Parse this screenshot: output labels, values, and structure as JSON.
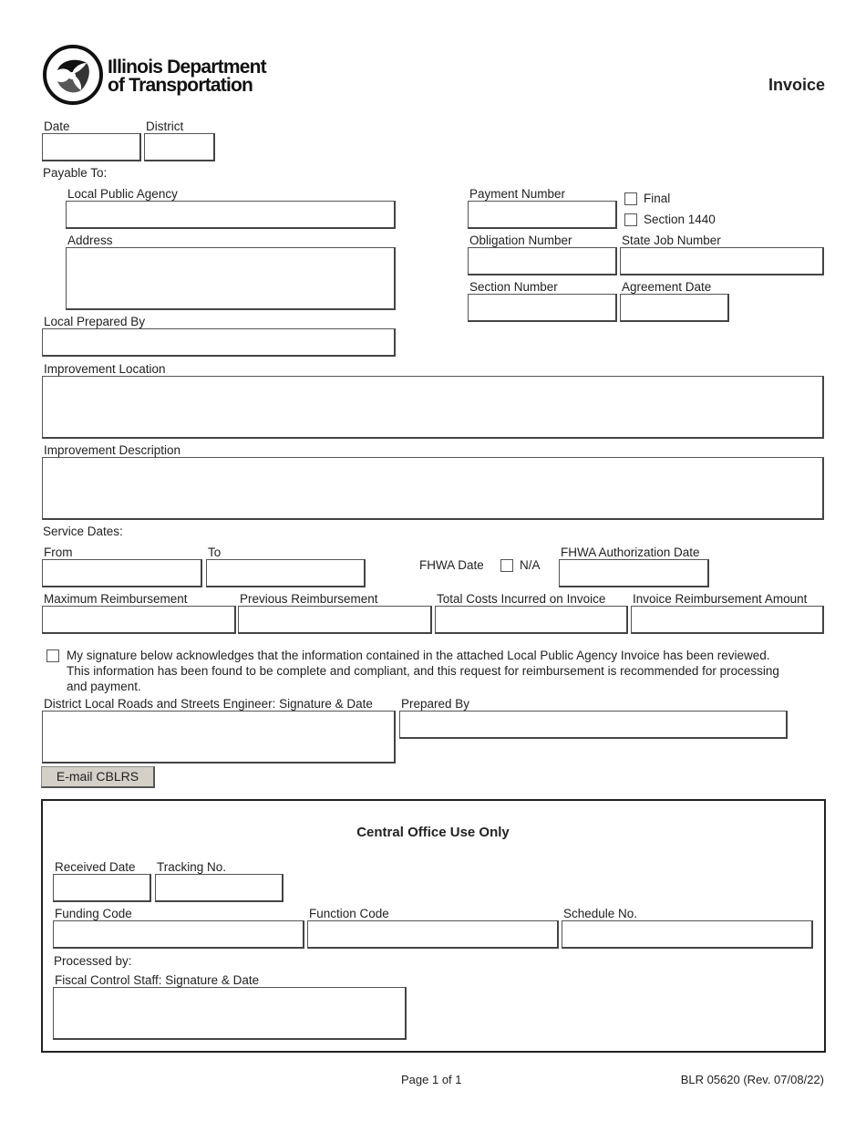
{
  "header": {
    "agency_line1": "Illinois Department",
    "agency_line2": "of Transportation",
    "form_title": "Invoice"
  },
  "fields": {
    "date": {
      "label": "Date",
      "value": ""
    },
    "district": {
      "label": "District",
      "value": ""
    },
    "payable_to": "Payable To:",
    "local_public_agency": {
      "label": "Local Public Agency",
      "value": ""
    },
    "address": {
      "label": "Address",
      "value": ""
    },
    "payment_number": {
      "label": "Payment Number",
      "value": ""
    },
    "final": {
      "label": "Final",
      "checked": false
    },
    "section_1440": {
      "label": "Section 1440",
      "checked": false
    },
    "obligation_number": {
      "label": "Obligation Number",
      "value": ""
    },
    "state_job_number": {
      "label": "State Job Number",
      "value": ""
    },
    "section_number": {
      "label": "Section Number",
      "value": ""
    },
    "agreement_date": {
      "label": "Agreement Date",
      "value": ""
    },
    "local_prepared_by": {
      "label": "Local Prepared By",
      "value": ""
    },
    "improvement_location": {
      "label": "Improvement Location",
      "value": ""
    },
    "improvement_description": {
      "label": "Improvement Description",
      "value": ""
    },
    "service_dates": "Service Dates:",
    "from": {
      "label": "From",
      "value": ""
    },
    "to": {
      "label": "To",
      "value": ""
    },
    "fhwa_date": {
      "label": "FHWA Date",
      "na_label": "N/A",
      "na_checked": false
    },
    "fhwa_authorization_date": {
      "label": "FHWA Authorization Date",
      "value": ""
    },
    "maximum_reimbursement": {
      "label": "Maximum Reimbursement",
      "value": ""
    },
    "previous_reimbursement": {
      "label": "Previous Reimbursement",
      "value": ""
    },
    "total_costs": {
      "label": "Total Costs Incurred on Invoice",
      "value": ""
    },
    "invoice_reimbursement_amount": {
      "label": "Invoice Reimbursement Amount",
      "value": ""
    },
    "acknowledgement": {
      "checked": false,
      "line1": "My signature below acknowledges that the information contained in the attached Local Public Agency Invoice has been reviewed.",
      "line2": "This information has been found to be complete and compliant, and this request for reimbursement is recommended for processing",
      "line3": "and payment."
    },
    "engineer_signature": {
      "label": "District Local Roads and Streets Engineer: Signature & Date",
      "value": ""
    },
    "prepared_by": {
      "label": "Prepared By",
      "value": ""
    }
  },
  "email_button": "E-mail CBLRS",
  "central_office": {
    "title": "Central Office Use Only",
    "received_date": {
      "label": "Received Date",
      "value": ""
    },
    "tracking_no": {
      "label": "Tracking No.",
      "value": ""
    },
    "funding_code": {
      "label": "Funding Code",
      "value": ""
    },
    "function_code": {
      "label": "Function Code",
      "value": ""
    },
    "schedule_no": {
      "label": "Schedule No.",
      "value": ""
    },
    "processed_by": "Processed by:",
    "fiscal_signature": {
      "label": "Fiscal Control Staff: Signature & Date",
      "value": ""
    }
  },
  "footer": {
    "page": "Page 1 of 1",
    "form_number": "BLR 05620 (Rev. 07/08/22)"
  }
}
